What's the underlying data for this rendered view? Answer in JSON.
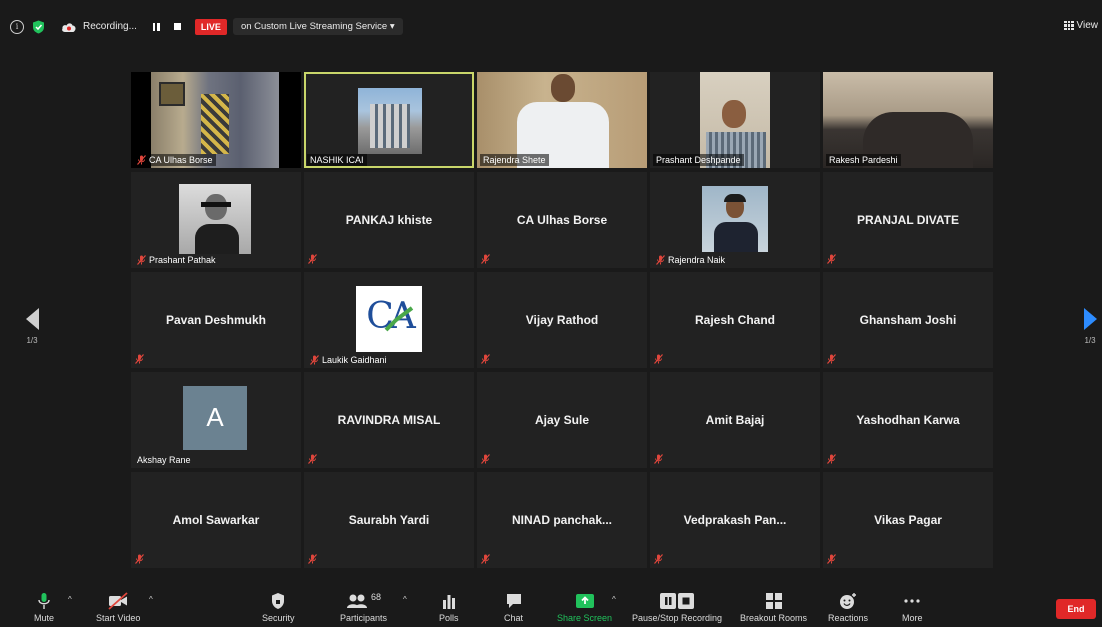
{
  "topbar": {
    "recording_label": "Recording...",
    "live_label": "LIVE",
    "stream_service": "on Custom Live Streaming Service",
    "view_label": "View"
  },
  "nav": {
    "prev_page": "1/3",
    "next_page": "1/3"
  },
  "tiles": [
    {
      "label": "CA Ulhas Borse",
      "kind": "video"
    },
    {
      "label": "NASHIK ICAI",
      "kind": "video"
    },
    {
      "label": "Rajendra Shete",
      "kind": "video"
    },
    {
      "label": "Prashant Deshpande",
      "kind": "video"
    },
    {
      "label": "Rakesh Pardeshi",
      "kind": "video"
    },
    {
      "label": "Prashant Pathak",
      "kind": "photo"
    },
    {
      "label": "PANKAJ khiste",
      "kind": "name"
    },
    {
      "label": "CA Ulhas Borse",
      "kind": "name"
    },
    {
      "label": "Rajendra Naik",
      "kind": "photo"
    },
    {
      "label": "PRANJAL DIVATE",
      "kind": "name"
    },
    {
      "label": "Pavan Deshmukh",
      "kind": "name"
    },
    {
      "label": "Laukik Gaidhani",
      "kind": "logo",
      "logo_text": "CA"
    },
    {
      "label": "Vijay Rathod",
      "kind": "name"
    },
    {
      "label": "Rajesh Chand",
      "kind": "name"
    },
    {
      "label": "Ghansham Joshi",
      "kind": "name"
    },
    {
      "label": "Akshay Rane",
      "kind": "avatar",
      "avatar_letter": "A"
    },
    {
      "label": "RAVINDRA MISAL",
      "kind": "name"
    },
    {
      "label": "Ajay Sule",
      "kind": "name"
    },
    {
      "label": "Amit Bajaj",
      "kind": "name"
    },
    {
      "label": "Yashodhan Karwa",
      "kind": "name"
    },
    {
      "label": "Amol Sawarkar",
      "kind": "name"
    },
    {
      "label": "Saurabh Yardi",
      "kind": "name"
    },
    {
      "label": "NINAD panchak...",
      "kind": "name"
    },
    {
      "label": "Vedprakash Pan...",
      "kind": "name"
    },
    {
      "label": "Vikas Pagar",
      "kind": "name"
    }
  ],
  "toolbar": {
    "mute": "Mute",
    "start_video": "Start Video",
    "security": "Security",
    "participants": "Participants",
    "participants_count": "68",
    "polls": "Polls",
    "chat": "Chat",
    "share_screen": "Share Screen",
    "pause_stop_recording": "Pause/Stop Recording",
    "breakout_rooms": "Breakout Rooms",
    "reactions": "Reactions",
    "more": "More",
    "end": "End"
  },
  "colors": {
    "live": "#e02828",
    "active_speaker": "#c9d66a",
    "share_green": "#21c25c",
    "mute_red": "#e0463c",
    "nav_blue": "#2d8cff"
  }
}
